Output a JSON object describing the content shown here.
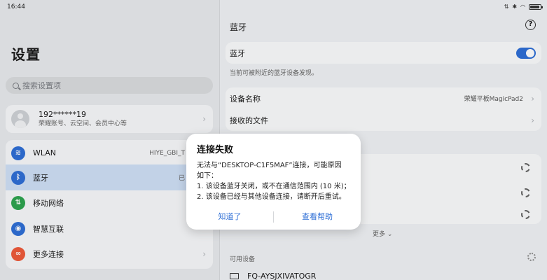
{
  "status_bar": {
    "time": "16:44",
    "battery_icon": "battery-icon"
  },
  "left": {
    "title": "设置",
    "search_placeholder": "搜索设置项",
    "account": {
      "name": "192******19",
      "subtitle": "荣耀账号、云空间、会员中心等"
    },
    "menu": [
      {
        "label": "WLAN",
        "value": "HIYE_GBI_T",
        "icon": "wifi-icon",
        "color": "#2f6fd6"
      },
      {
        "label": "蓝牙",
        "value": "已",
        "icon": "bluetooth-icon",
        "color": "#2f6fd6",
        "selected": true
      },
      {
        "label": "移动网络",
        "value": "",
        "icon": "mobile-data-icon",
        "color": "#2ea44f"
      },
      {
        "label": "智慧互联",
        "value": "",
        "icon": "smart-connect-icon",
        "color": "#2f6fd6"
      },
      {
        "label": "更多连接",
        "value": "",
        "icon": "more-connections-icon",
        "color": "#ef5b3b"
      }
    ]
  },
  "right": {
    "title": "蓝牙",
    "bluetooth_label": "蓝牙",
    "bluetooth_on": true,
    "hint": "当前可被附近的蓝牙设备发现。",
    "device_name_label": "设备名称",
    "device_name_value": "荣耀平板MagicPad2",
    "received_files_label": "接收的文件",
    "more_label": "更多",
    "available_label": "可用设备",
    "available_device": "FQ-AYSJXIVATOGR"
  },
  "dialog": {
    "title": "连接失败",
    "body_lines": [
      "无法与“DESKTOP-C1F5MAF”连接，可能原因",
      "如下：",
      "1. 该设备蓝牙关闭，或不在通信范围内 (10 米)；",
      "2. 该设备已经与其他设备连接，请断开后重试。"
    ],
    "ok_label": "知道了",
    "help_label": "查看帮助",
    "accent": "#2f6fd6"
  }
}
